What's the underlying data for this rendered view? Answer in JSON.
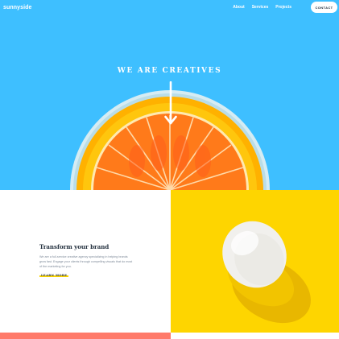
{
  "header": {
    "logo": "sunnyside",
    "nav": [
      {
        "label": "About"
      },
      {
        "label": "Services"
      },
      {
        "label": "Projects"
      }
    ],
    "cta_label": "CONTACT"
  },
  "hero": {
    "title": "WE ARE CREATIVES",
    "background_color": "#3ebfff",
    "icon": "arrow-down-icon"
  },
  "transform": {
    "heading": "Transform your brand",
    "body": "We are a full-service creative agency specializing in helping brands grow fast. Engage your clients through compelling visuals that do most of the marketing for you.",
    "link_label": "LEARN MORE",
    "underline_color": "#fad400"
  },
  "egg_panel": {
    "background_color": "#fed500"
  },
  "bottom_strip": {
    "color": "#ff7a6a"
  }
}
